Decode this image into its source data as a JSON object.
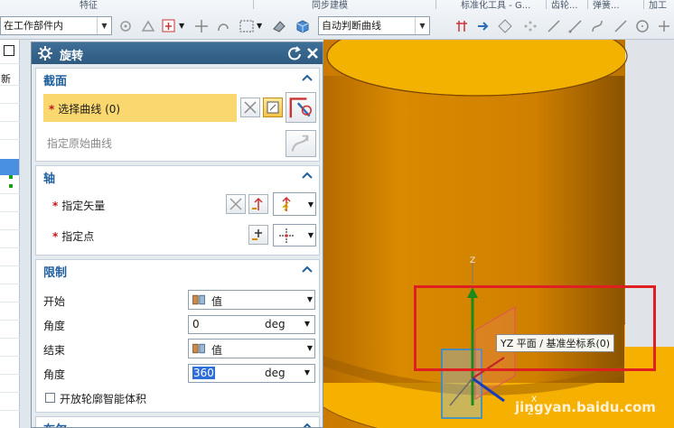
{
  "ribbon": {
    "groups": [
      "特征",
      "同步建模",
      "标准化工具 - G...",
      "齿轮...",
      "弹簧...",
      "加工"
    ],
    "filter_combo": "在工作部件内",
    "curve_rule_combo": "自动判断曲线"
  },
  "left_strip": {
    "header": "新"
  },
  "dialog": {
    "title": "旋转",
    "section_profile": {
      "title": "截面",
      "select_curve": "选择曲线 (0)",
      "origin_curve": "指定原始曲线"
    },
    "section_axis": {
      "title": "轴",
      "vector": "指定矢量",
      "point": "指定点"
    },
    "section_limits": {
      "title": "限制",
      "start_label": "开始",
      "start_mode": "值",
      "start_angle_label": "角度",
      "start_angle": "0",
      "start_unit": "deg",
      "end_label": "结束",
      "end_mode": "值",
      "end_angle_label": "角度",
      "end_angle": "360",
      "end_unit": "deg",
      "open_profile": "开放轮廓智能体积"
    },
    "section_boolean": {
      "title": "布尔"
    }
  },
  "viewport": {
    "tooltip": "YZ 平面 / 基准坐标系(0)",
    "axis_z_top": "Z",
    "axis_z_small": "Z",
    "axis_x": "X",
    "watermark": "jingyan.baidu.com",
    "colors": {
      "body": "#f2a700",
      "highlight": "#e02020",
      "plane": "#1e88e5"
    }
  }
}
